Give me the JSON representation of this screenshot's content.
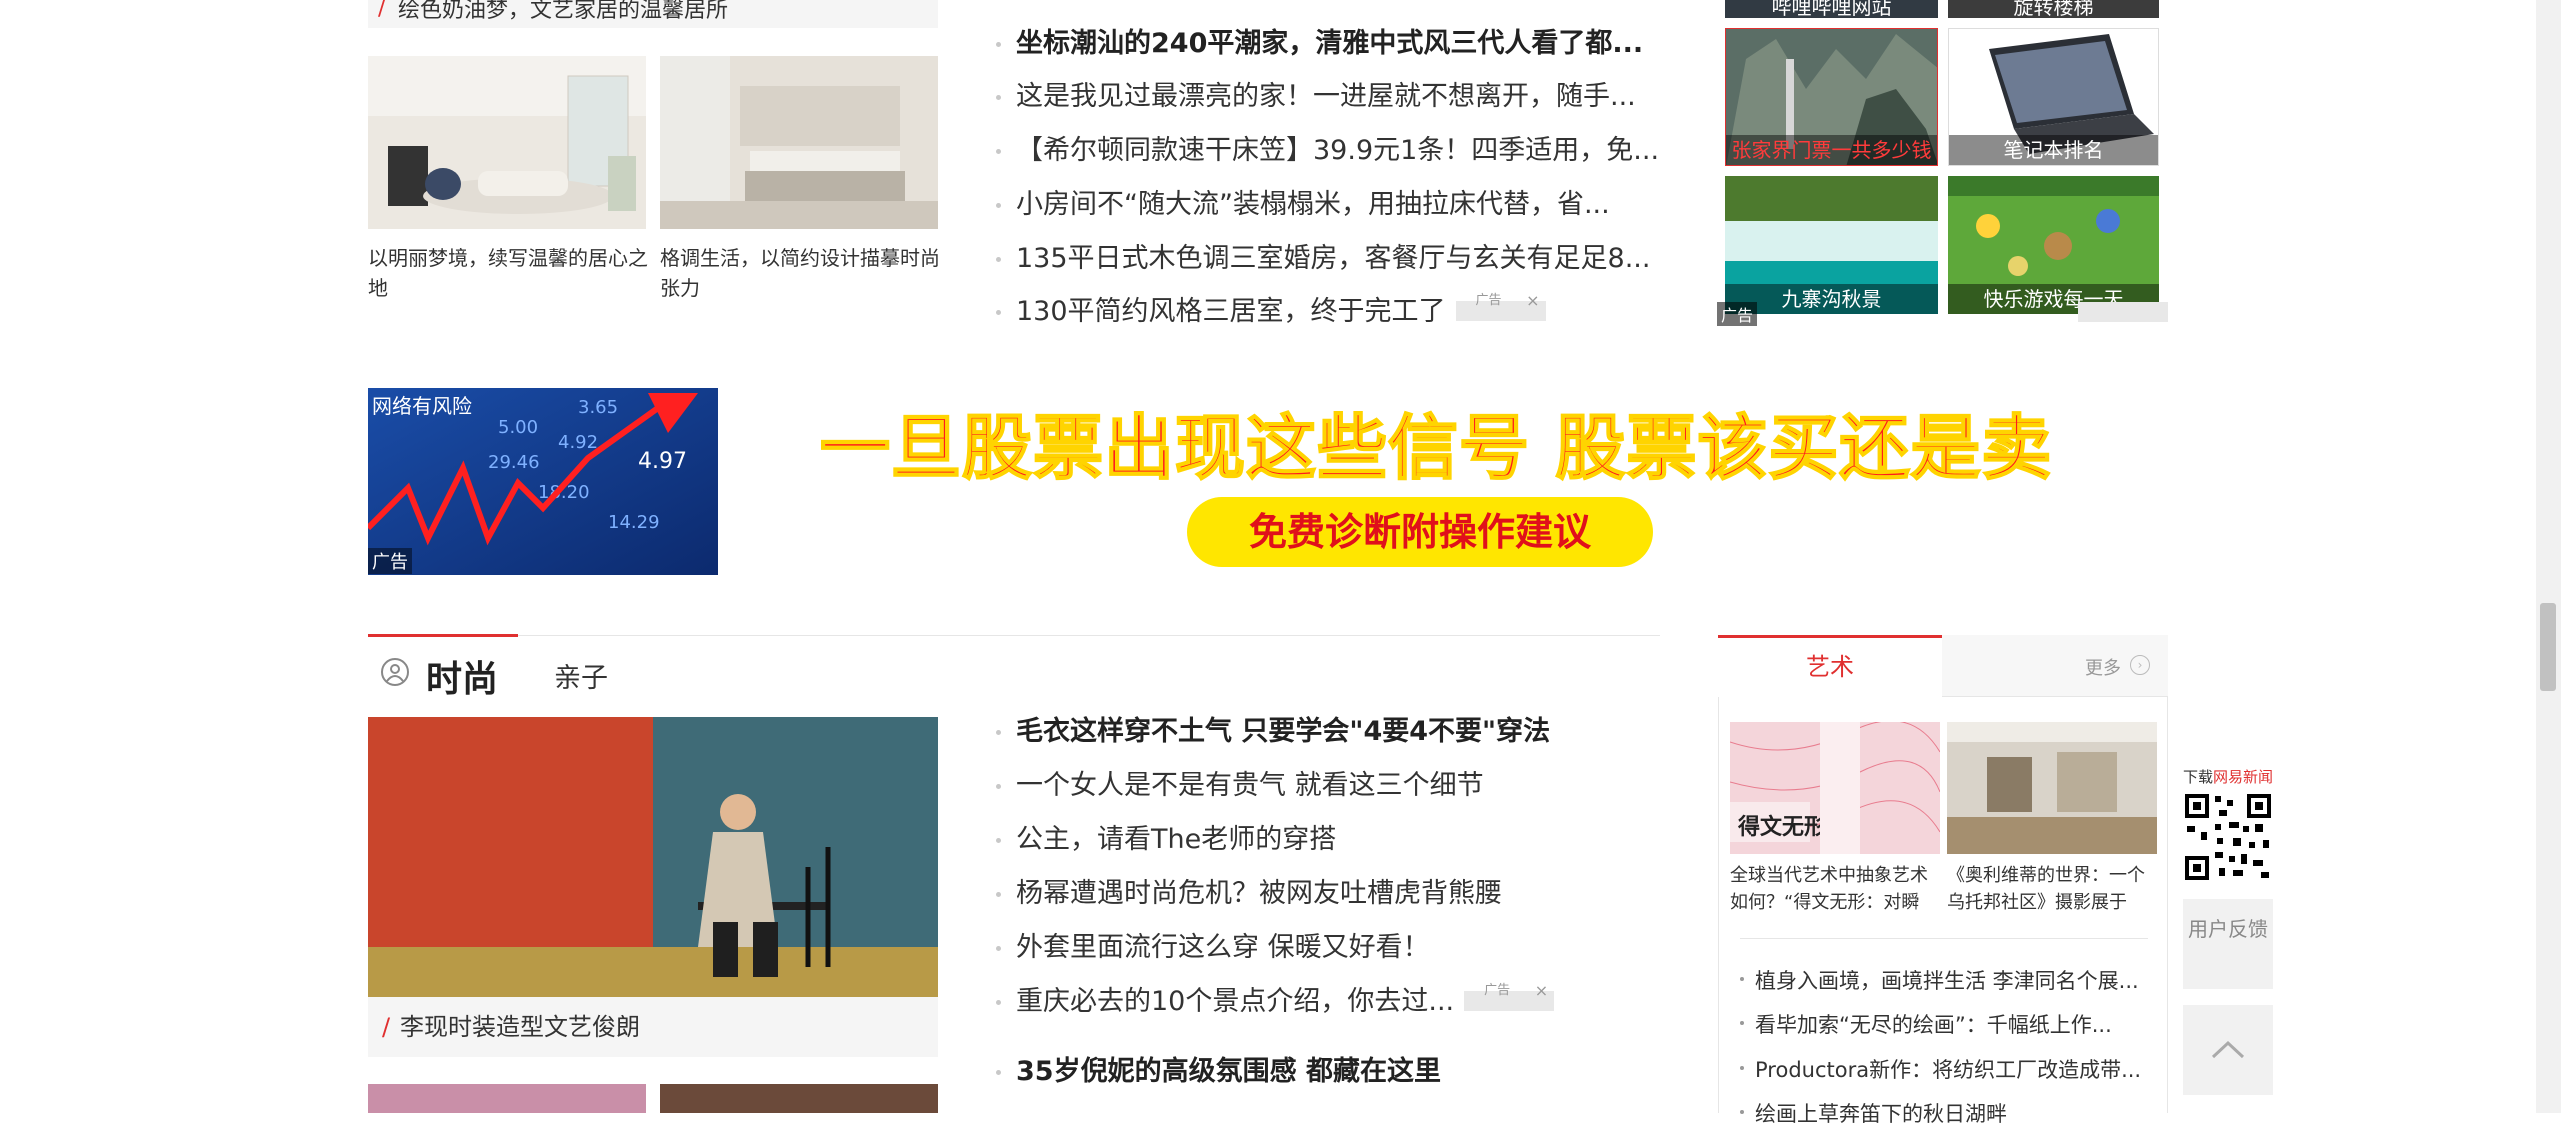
{
  "top": {
    "caption": "绘色奶油梦，文艺家居的温馨居所",
    "photos": [
      {
        "caption": "以明丽梦境，续写温馨的居心之地"
      },
      {
        "caption": "格调生活，以简约设计描摹时尚张力"
      }
    ],
    "news": [
      {
        "text": "坐标潮汕的240平潮家，清雅中式风三代人看了都...",
        "bold": true
      },
      {
        "text": "这是我见过最漂亮的家！一进屋就不想离开，随手..."
      },
      {
        "text": "【希尔顿同款速干床笠】39.9元1条！四季适用，免..."
      },
      {
        "text": "小房间不“随大流”装榻榻米，用抽拉床代替，省..."
      },
      {
        "text": "135平日式木色调三室婚房，客餐厅与玄关有足足8..."
      },
      {
        "text": "130平简约风格三居室，终于完工了"
      }
    ],
    "ad_tag": "广告",
    "thumbs": [
      {
        "label": "哔哩哔哩网站"
      },
      {
        "label": "旋转楼梯"
      },
      {
        "label": "张家界门票一共多少钱"
      },
      {
        "label": "笔记本排名"
      },
      {
        "label": "九寨沟秋景"
      },
      {
        "label": "快乐游戏每一天"
      }
    ],
    "thumbs_ad": "广告"
  },
  "banner": {
    "image_label": "网络有风险",
    "ad_label": "广告",
    "headline": "一旦股票出现这些信号 股票该买还是卖",
    "cta": "免费诊断附操作建议"
  },
  "fashion": {
    "title": "时尚",
    "tab2": "亲子",
    "photo_caption": "李现时装造型文艺俊朗",
    "news": [
      {
        "text": "毛衣这样穿不土气 只要学会\"4要4不要\"穿法",
        "bold": true
      },
      {
        "text": "一个女人是不是有贵气 就看这三个细节"
      },
      {
        "text": "公主，请看The老师的穿搭"
      },
      {
        "text": "杨幂遭遇时尚危机？被网友吐槽虎背熊腰"
      },
      {
        "text": "外套里面流行这么穿 保暖又好看！"
      },
      {
        "text": "重庆必去的10个景点介绍，你去过..."
      },
      {
        "text": "35岁倪妮的高级氛围感 都藏在这里",
        "bold": true
      }
    ]
  },
  "art": {
    "tab": "艺术",
    "more": "更多",
    "cards": [
      {
        "caption": "全球当代艺术中抽象艺术如何？“得文无形：对瞬"
      },
      {
        "caption": "《奥利维蒂的世界：一个乌托邦社区》摄影展于"
      }
    ],
    "list": [
      "植身入画境，画境拌生活 李津同名个展...",
      "看毕加索“无尽的绘画”：千幅纸上作...",
      "Productora新作：将纺织工厂改造成带...",
      "绘画上草奔笛下的秋日湖畔"
    ]
  },
  "side": {
    "qr_label_prefix": "下载",
    "qr_label_brand": "网易新闻",
    "feedback": "用户反馈"
  },
  "colors": {
    "accent": "#e03030",
    "headline_red": "#ff1b1b",
    "cta_yellow": "#ffe600"
  }
}
